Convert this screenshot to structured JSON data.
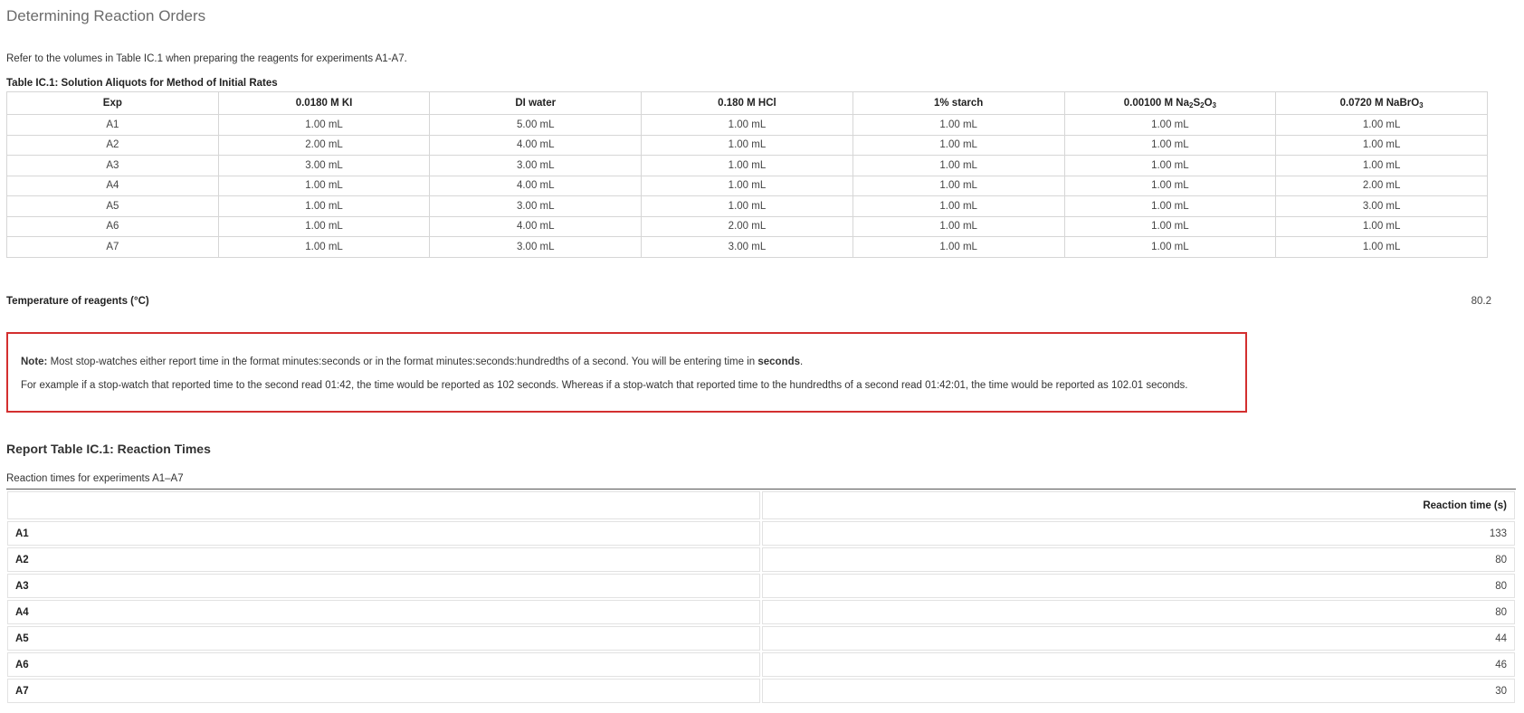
{
  "page": {
    "title": "Determining Reaction Orders",
    "intro": "Refer to the volumes in Table IC.1 when preparing the reagents for experiments A1-A7."
  },
  "aliquot_table": {
    "caption": "Table IC.1: Solution Aliquots for Method of Initial Rates",
    "headers": {
      "exp": "Exp",
      "ki": "0.0180 M KI",
      "water": "DI water",
      "hcl": "0.180 M HCl",
      "starch": "1% starch",
      "thio_prefix": "0.00100 M Na",
      "thio_s": "S",
      "thio_o": "O",
      "thio_sub2": "2",
      "thio_sub3": "3",
      "bromate_prefix": "0.0720 M NaBrO",
      "bromate_sub": "3"
    },
    "rows": [
      [
        "A1",
        "1.00 mL",
        "5.00 mL",
        "1.00 mL",
        "1.00 mL",
        "1.00 mL",
        "1.00 mL"
      ],
      [
        "A2",
        "2.00 mL",
        "4.00 mL",
        "1.00 mL",
        "1.00 mL",
        "1.00 mL",
        "1.00 mL"
      ],
      [
        "A3",
        "3.00 mL",
        "3.00 mL",
        "1.00 mL",
        "1.00 mL",
        "1.00 mL",
        "1.00 mL"
      ],
      [
        "A4",
        "1.00 mL",
        "4.00 mL",
        "1.00 mL",
        "1.00 mL",
        "1.00 mL",
        "2.00 mL"
      ],
      [
        "A5",
        "1.00 mL",
        "3.00 mL",
        "1.00 mL",
        "1.00 mL",
        "1.00 mL",
        "3.00 mL"
      ],
      [
        "A6",
        "1.00 mL",
        "4.00 mL",
        "2.00 mL",
        "1.00 mL",
        "1.00 mL",
        "1.00 mL"
      ],
      [
        "A7",
        "1.00 mL",
        "3.00 mL",
        "3.00 mL",
        "1.00 mL",
        "1.00 mL",
        "1.00 mL"
      ]
    ]
  },
  "temperature": {
    "label": "Temperature of reagents (°C)",
    "value": "80.2"
  },
  "note": {
    "bold_label": "Note:",
    "line1_text": " Most stop-watches either report time in the format minutes:seconds or in the format minutes:seconds:hundredths of a second. You will be entering time in ",
    "line1_bold": "seconds",
    "line1_end": ".",
    "line2": "For example if a stop-watch that reported time to the second read 01:42, the time would be reported as 102 seconds. Whereas if a stop-watch that reported time to the hundredths of a second read 01:42:01, the time would be reported as 102.01 seconds.",
    "border_color": "#d32f2f"
  },
  "report": {
    "title": "Report Table IC.1: Reaction Times",
    "caption": "Reaction times for experiments A1–A7",
    "value_header": "Reaction time (s)",
    "rows": [
      {
        "label": "A1",
        "value": "133"
      },
      {
        "label": "A2",
        "value": "80"
      },
      {
        "label": "A3",
        "value": "80"
      },
      {
        "label": "A4",
        "value": "80"
      },
      {
        "label": "A5",
        "value": "44"
      },
      {
        "label": "A6",
        "value": "46"
      },
      {
        "label": "A7",
        "value": "30"
      }
    ]
  }
}
